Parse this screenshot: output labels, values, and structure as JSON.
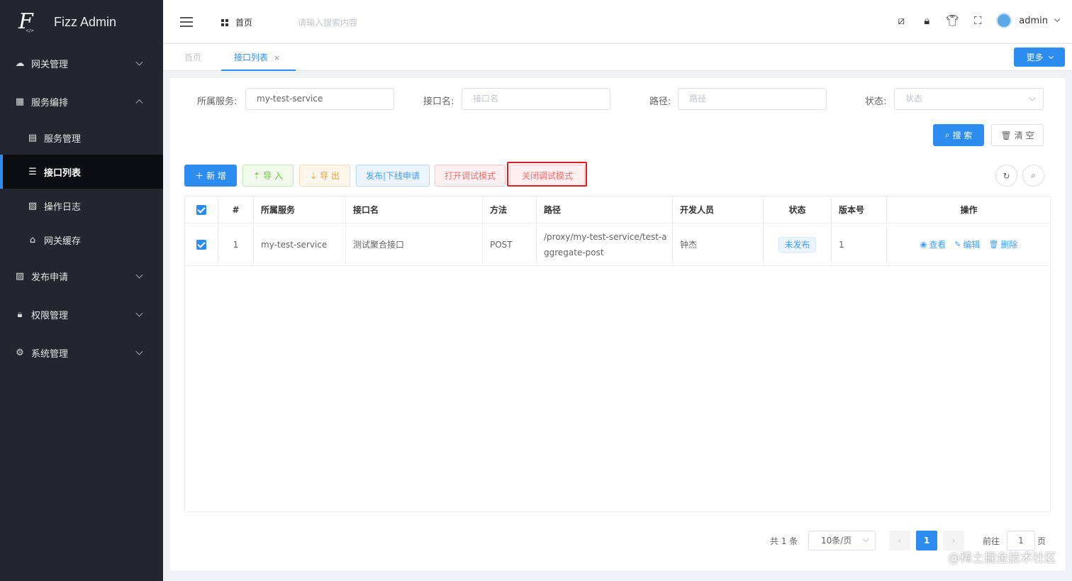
{
  "app": {
    "title": "Fizz Admin",
    "logo_tag": "</>"
  },
  "sidebar": {
    "items": [
      {
        "label": "网关管理",
        "icon": "cloud-icon"
      },
      {
        "label": "服务编排",
        "icon": "grid-icon",
        "expanded": true,
        "children": [
          {
            "label": "服务管理",
            "icon": "service-icon"
          },
          {
            "label": "接口列表",
            "icon": "list-icon",
            "active": true
          },
          {
            "label": "操作日志",
            "icon": "log-icon"
          },
          {
            "label": "网关缓存",
            "icon": "cache-icon"
          }
        ]
      },
      {
        "label": "发布申请",
        "icon": "publish-icon"
      },
      {
        "label": "权限管理",
        "icon": "lock-icon"
      },
      {
        "label": "系统管理",
        "icon": "gear-icon"
      }
    ]
  },
  "header": {
    "breadcrumb": "首页",
    "search_placeholder": "请输入搜索内容",
    "user": "admin"
  },
  "tabs": [
    {
      "label": "首页"
    },
    {
      "label": "接口列表",
      "active": true,
      "close": "×"
    }
  ],
  "more_button": "更多",
  "filters": {
    "service_label": "所属服务:",
    "service_value": "my-test-service",
    "api_label": "接口名:",
    "api_placeholder": "接口名",
    "path_label": "路径:",
    "path_placeholder": "路径",
    "status_label": "状态:",
    "status_placeholder": "状态",
    "search_button": "搜 索",
    "clear_button": "清 空"
  },
  "toolbar": {
    "new": "新 增",
    "import": "导 入",
    "export": "导 出",
    "publish": "发布|下线申请",
    "debug_on": "打开调试模式",
    "debug_off": "关闭调试模式"
  },
  "table": {
    "headers": [
      "#",
      "所属服务",
      "接口名",
      "方法",
      "路径",
      "开发人员",
      "状态",
      "版本号",
      "操作"
    ],
    "rows": [
      {
        "index": "1",
        "service": "my-test-service",
        "name": "测试聚合接口",
        "method": "POST",
        "path": "/proxy/my-test-service/test-aggregate-post",
        "developer": "钟杰",
        "status": "未发布",
        "version": "1",
        "ops": [
          "查看",
          "编辑",
          "删除"
        ]
      }
    ]
  },
  "pagination": {
    "total": "共 1 条",
    "page_size": "10条/页",
    "current": "1",
    "goto_label": "前往",
    "goto_value": "1",
    "page_suffix": "页"
  },
  "watermark": "@稀土掘金技术社区",
  "colors": {
    "primary": "#2d8cf0",
    "sidebar": "#23262e",
    "highlight": "#e02020"
  }
}
